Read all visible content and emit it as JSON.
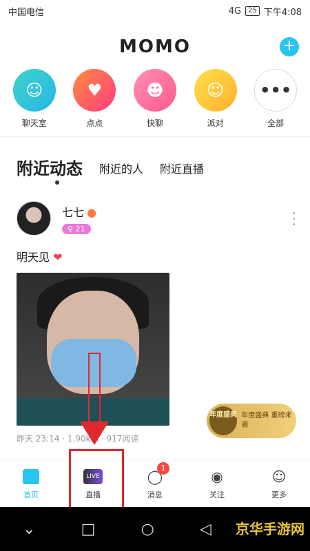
{
  "status_bar": {
    "carrier": "中国电信",
    "right_text": "4G",
    "battery": "25",
    "time": "下午4:08"
  },
  "header": {
    "title": "MOMO",
    "add_label": "+"
  },
  "quick_entries": [
    {
      "label": "聊天室",
      "icon": "chat-room-icon"
    },
    {
      "label": "点点",
      "icon": "dian-dian-icon"
    },
    {
      "label": "快聊",
      "icon": "quick-chat-icon"
    },
    {
      "label": "派对",
      "icon": "party-icon"
    },
    {
      "label": "全部",
      "icon": "more-icon"
    }
  ],
  "tabs": [
    {
      "label": "附近动态",
      "active": true
    },
    {
      "label": "附近的人",
      "active": false
    },
    {
      "label": "附近直播",
      "active": false
    }
  ],
  "post": {
    "username": "七七",
    "age": "♀ 21",
    "text": "明天见",
    "meta": "昨天 23:14 · 1.90km · 917阅读"
  },
  "float_banner": {
    "badge": "年度盛典",
    "text": "年度盛典 重磅来袭"
  },
  "bottom_nav": [
    {
      "label": "首页",
      "icon": "home-icon",
      "active": true
    },
    {
      "label": "直播",
      "icon": "live-icon",
      "active": false
    },
    {
      "label": "消息",
      "icon": "message-icon",
      "active": false,
      "badge": "1"
    },
    {
      "label": "关注",
      "icon": "follow-eye-icon",
      "active": false
    },
    {
      "label": "更多",
      "icon": "profile-icon",
      "active": false
    }
  ],
  "watermark": "京华手游网",
  "colors": {
    "accent": "#28c5ef",
    "annotation": "#e0282e"
  }
}
